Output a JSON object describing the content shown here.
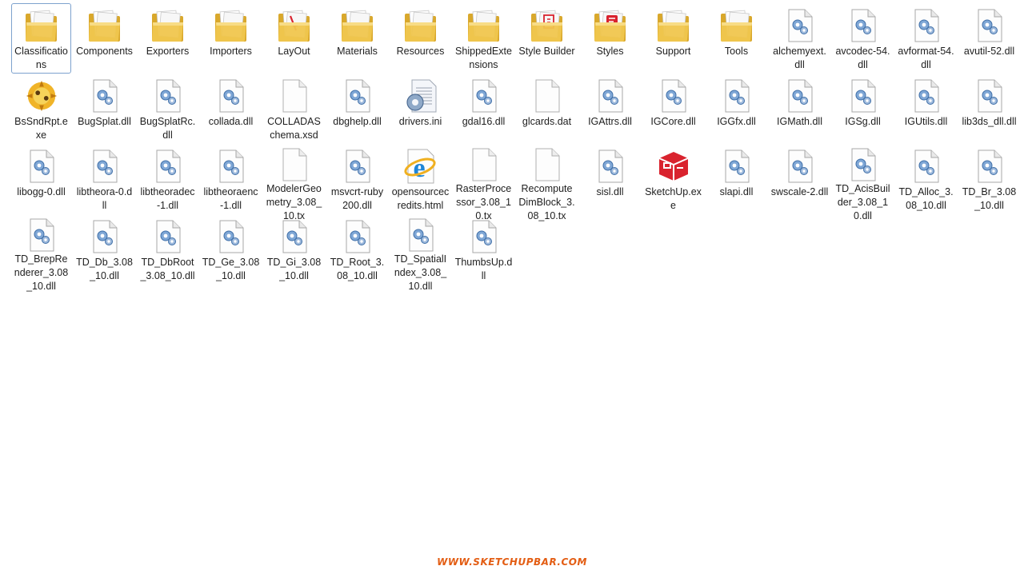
{
  "files": [
    {
      "name": "Classifications",
      "icon": "folder-icon",
      "selected": true
    },
    {
      "name": "Components",
      "icon": "folder-icon"
    },
    {
      "name": "Exporters",
      "icon": "folder-icon"
    },
    {
      "name": "Importers",
      "icon": "folder-icon"
    },
    {
      "name": "LayOut",
      "icon": "folder-layout-icon"
    },
    {
      "name": "Materials",
      "icon": "folder-icon"
    },
    {
      "name": "Resources",
      "icon": "folder-icon"
    },
    {
      "name": "ShippedExtensions",
      "icon": "folder-icon"
    },
    {
      "name": "Style Builder",
      "icon": "folder-stylebuilder-icon"
    },
    {
      "name": "Styles",
      "icon": "folder-styles-icon"
    },
    {
      "name": "Support",
      "icon": "folder-icon"
    },
    {
      "name": "Tools",
      "icon": "folder-icon"
    },
    {
      "name": "alchemyext.dll",
      "icon": "dll-icon"
    },
    {
      "name": "avcodec-54.dll",
      "icon": "dll-icon"
    },
    {
      "name": "avformat-54.dll",
      "icon": "dll-icon"
    },
    {
      "name": "avutil-52.dll",
      "icon": "dll-icon"
    },
    {
      "name": "BsSndRpt.exe",
      "icon": "bssndrpt-app-icon"
    },
    {
      "name": "BugSplat.dll",
      "icon": "dll-icon"
    },
    {
      "name": "BugSplatRc.dll",
      "icon": "dll-icon"
    },
    {
      "name": "collada.dll",
      "icon": "dll-icon"
    },
    {
      "name": "COLLADASchema.xsd",
      "icon": "blank-file-icon"
    },
    {
      "name": "dbghelp.dll",
      "icon": "dll-icon"
    },
    {
      "name": "drivers.ini",
      "icon": "ini-settings-icon"
    },
    {
      "name": "gdal16.dll",
      "icon": "dll-icon"
    },
    {
      "name": "glcards.dat",
      "icon": "blank-file-icon"
    },
    {
      "name": "IGAttrs.dll",
      "icon": "dll-icon"
    },
    {
      "name": "IGCore.dll",
      "icon": "dll-icon"
    },
    {
      "name": "IGGfx.dll",
      "icon": "dll-icon"
    },
    {
      "name": "IGMath.dll",
      "icon": "dll-icon"
    },
    {
      "name": "IGSg.dll",
      "icon": "dll-icon"
    },
    {
      "name": "IGUtils.dll",
      "icon": "dll-icon"
    },
    {
      "name": "lib3ds_dll.dll",
      "icon": "dll-icon"
    },
    {
      "name": "libogg-0.dll",
      "icon": "dll-icon"
    },
    {
      "name": "libtheora-0.dll",
      "icon": "dll-icon"
    },
    {
      "name": "libtheoradec-1.dll",
      "icon": "dll-icon"
    },
    {
      "name": "libtheoraenc-1.dll",
      "icon": "dll-icon"
    },
    {
      "name": "ModelerGeometry_3.08_10.tx",
      "icon": "blank-file-icon"
    },
    {
      "name": "msvcrt-ruby200.dll",
      "icon": "dll-icon"
    },
    {
      "name": "opensourcecredits.html",
      "icon": "internet-explorer-icon"
    },
    {
      "name": "RasterProcessor_3.08_10.tx",
      "icon": "blank-file-icon"
    },
    {
      "name": "RecomputeDimBlock_3.08_10.tx",
      "icon": "blank-file-icon"
    },
    {
      "name": "sisl.dll",
      "icon": "dll-icon"
    },
    {
      "name": "SketchUp.exe",
      "icon": "sketchup-app-icon"
    },
    {
      "name": "slapi.dll",
      "icon": "dll-icon"
    },
    {
      "name": "swscale-2.dll",
      "icon": "dll-icon"
    },
    {
      "name": "TD_AcisBuilder_3.08_10.dll",
      "icon": "dll-icon"
    },
    {
      "name": "TD_Alloc_3.08_10.dll",
      "icon": "dll-icon"
    },
    {
      "name": "TD_Br_3.08_10.dll",
      "icon": "dll-icon"
    },
    {
      "name": "TD_BrepRenderer_3.08_10.dll",
      "icon": "dll-icon"
    },
    {
      "name": "TD_Db_3.08_10.dll",
      "icon": "dll-icon"
    },
    {
      "name": "TD_DbRoot_3.08_10.dll",
      "icon": "dll-icon"
    },
    {
      "name": "TD_Ge_3.08_10.dll",
      "icon": "dll-icon"
    },
    {
      "name": "TD_Gi_3.08_10.dll",
      "icon": "dll-icon"
    },
    {
      "name": "TD_Root_3.08_10.dll",
      "icon": "dll-icon"
    },
    {
      "name": "TD_SpatialIndex_3.08_10.dll",
      "icon": "dll-icon"
    },
    {
      "name": "ThumbsUp.dll",
      "icon": "dll-icon"
    }
  ],
  "footer": {
    "brand": "WWW.SKETCHUPBAR.COM"
  },
  "colors": {
    "folder": "#f0c64e",
    "accent_red": "#d9232e",
    "selection_border": "#7da2ce",
    "brand_orange": "#e35d13"
  }
}
